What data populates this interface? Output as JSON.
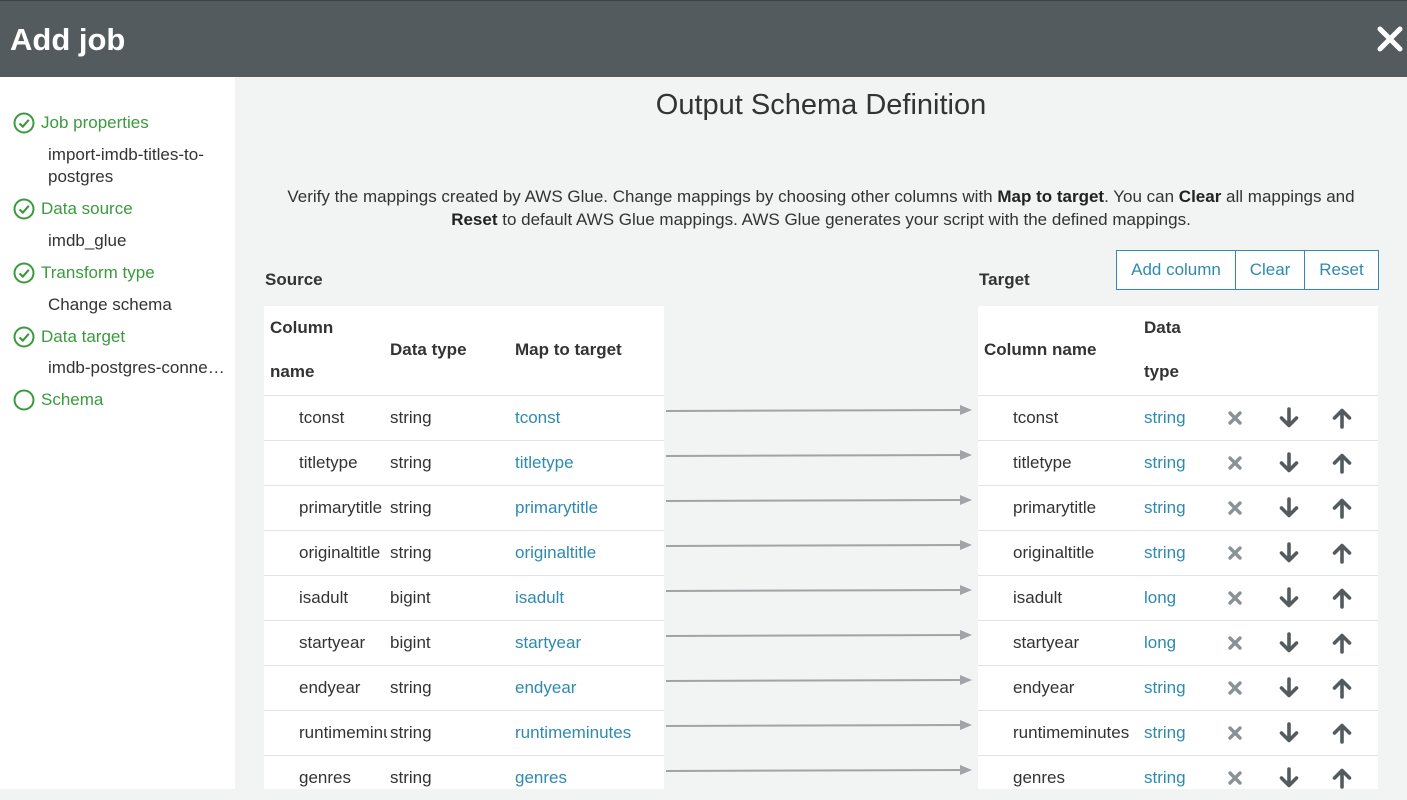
{
  "header": {
    "title": "Add job"
  },
  "sidebar": {
    "steps": [
      {
        "label": "Job properties",
        "value": "import-imdb-titles-to-postgres",
        "status": "complete"
      },
      {
        "label": "Data source",
        "value": "imdb_glue",
        "status": "complete"
      },
      {
        "label": "Transform type",
        "value": "Change schema",
        "status": "complete"
      },
      {
        "label": "Data target",
        "value": "imdb-postgres-connection",
        "status": "complete"
      },
      {
        "label": "Schema",
        "value": "",
        "status": "current"
      }
    ]
  },
  "main": {
    "title": "Output Schema Definition",
    "desc": {
      "p1": "Verify the mappings created by AWS Glue. Change mappings by choosing other columns with ",
      "b1": "Map to target",
      "p2": ". You can ",
      "b2": "Clear",
      "p3": " all mappings and",
      "b3": "Reset",
      "p4": " to default AWS Glue mappings. AWS Glue generates your script with the defined mappings."
    },
    "source_label": "Source",
    "target_label": "Target",
    "buttons": {
      "add_column": "Add column",
      "clear": "Clear",
      "reset": "Reset"
    },
    "source_headers": {
      "column_name_1": "Column",
      "column_name_2": "name",
      "data_type": "Data type",
      "map_to_target": "Map to target"
    },
    "target_headers": {
      "column_name": "Column name",
      "data_type_1": "Data",
      "data_type_2": "type"
    },
    "rows": [
      {
        "src": "tconst",
        "src_type": "string",
        "map": "tconst",
        "tgt": "tconst",
        "tgt_type": "string"
      },
      {
        "src": "titletype",
        "src_type": "string",
        "map": "titletype",
        "tgt": "titletype",
        "tgt_type": "string"
      },
      {
        "src": "primarytitle",
        "src_type": "string",
        "map": "primarytitle",
        "tgt": "primarytitle",
        "tgt_type": "string"
      },
      {
        "src": "originaltitle",
        "src_type": "string",
        "map": "originaltitle",
        "tgt": "originaltitle",
        "tgt_type": "string"
      },
      {
        "src": "isadult",
        "src_type": "bigint",
        "map": "isadult",
        "tgt": "isadult",
        "tgt_type": "long"
      },
      {
        "src": "startyear",
        "src_type": "bigint",
        "map": "startyear",
        "tgt": "startyear",
        "tgt_type": "long"
      },
      {
        "src": "endyear",
        "src_type": "string",
        "map": "endyear",
        "tgt": "endyear",
        "tgt_type": "string"
      },
      {
        "src": "runtimeminutes",
        "src_type": "string",
        "map": "runtimeminutes",
        "tgt": "runtimeminutes",
        "tgt_type": "string"
      },
      {
        "src": "genres",
        "src_type": "string",
        "map": "genres",
        "tgt": "genres",
        "tgt_type": "string"
      }
    ],
    "icons": {
      "delete": "x-icon",
      "move_down": "arrow-down-icon",
      "move_up": "arrow-up-icon"
    }
  },
  "colors": {
    "header_bg": "#545b5e",
    "link": "#2f8ab0",
    "success": "#3b9a3d",
    "icon_gray": "#8b9295",
    "icon_dark": "#545b5e"
  }
}
